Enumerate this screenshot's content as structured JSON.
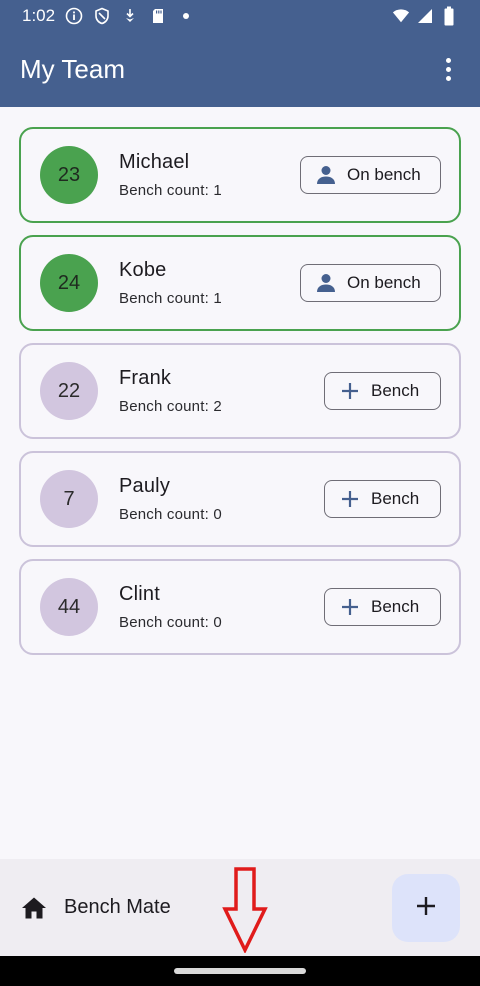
{
  "status_bar": {
    "time": "1:02",
    "icons": [
      "info-icon",
      "shield-icon",
      "download-icon",
      "sd-card-icon",
      "dot-icon",
      "wifi-icon",
      "signal-icon",
      "battery-icon"
    ]
  },
  "app_bar": {
    "title": "My Team",
    "menu_icon": "more-vert-icon"
  },
  "players": [
    {
      "number": "23",
      "name": "Michael",
      "bench_count": "Bench count: 1",
      "benched": true,
      "button_label": "On bench",
      "button_icon": "person-icon"
    },
    {
      "number": "24",
      "name": "Kobe",
      "bench_count": "Bench count: 1",
      "benched": true,
      "button_label": "On bench",
      "button_icon": "person-icon"
    },
    {
      "number": "22",
      "name": "Frank",
      "bench_count": "Bench count: 2",
      "benched": false,
      "button_label": "Bench",
      "button_icon": "plus-icon"
    },
    {
      "number": "7",
      "name": "Pauly",
      "bench_count": "Bench count: 0",
      "benched": false,
      "button_label": "Bench",
      "button_icon": "plus-icon"
    },
    {
      "number": "44",
      "name": "Clint",
      "bench_count": "Bench count: 0",
      "benched": false,
      "button_label": "Bench",
      "button_icon": "plus-icon"
    }
  ],
  "bottom_bar": {
    "icon": "home-icon",
    "label": "Bench Mate",
    "fab_icon": "plus-icon"
  },
  "colors": {
    "primary": "#45608f",
    "benched_green": "#4aa24f",
    "default_avatar": "#d2c6df",
    "fab_bg": "#dde3fa",
    "annotation_red": "#e01b1b"
  }
}
